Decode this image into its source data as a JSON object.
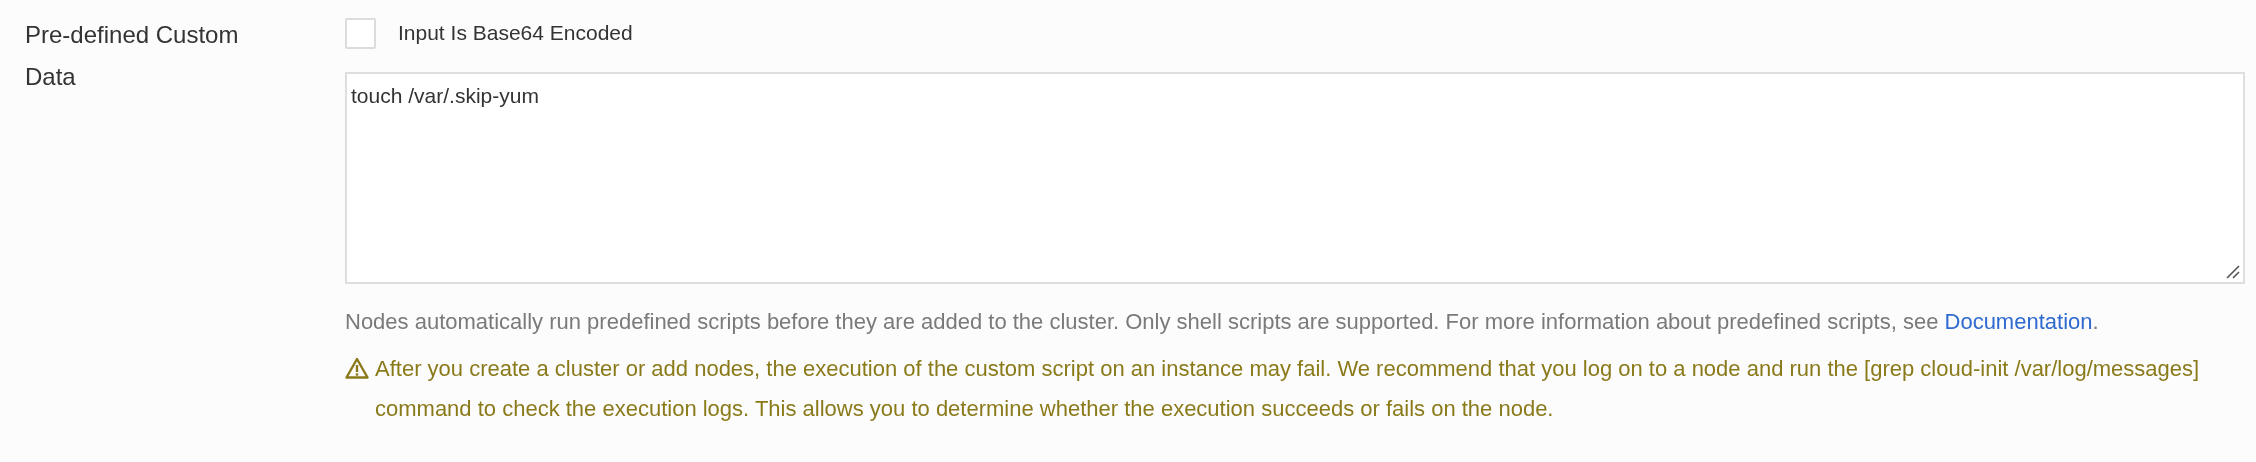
{
  "field": {
    "label": "Pre-defined Custom Data",
    "checkbox": {
      "label": "Input Is Base64 Encoded",
      "checked": false
    },
    "textarea": {
      "value": "touch /var/.skip-yum"
    },
    "help": {
      "text": "Nodes automatically run predefined scripts before they are added to the cluster. Only shell scripts are supported. For more information about predefined scripts, see ",
      "link": "Documentation",
      "suffix": "."
    },
    "warning": {
      "text": "After you create a cluster or add nodes, the execution of the custom script on an instance may fail. We recommend that you log on to a node and run the [grep cloud-init /var/log/messages] command to check the execution logs. This allows you to determine whether the execution succeeds or fails on the node."
    }
  }
}
